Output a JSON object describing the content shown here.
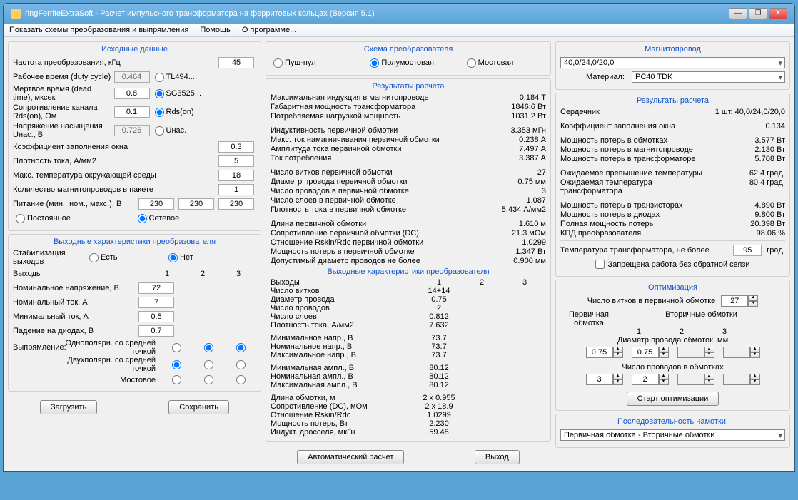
{
  "title": "ringFerriteExtraSoft - Расчет импульсного трансформатора на ферритовых кольцах (Версия 5.1)",
  "menu": {
    "schemes": "Показать схемы преобразования и выпрямления",
    "help": "Помощь",
    "about": "О программе..."
  },
  "sourceData": {
    "title": "Исходные данные",
    "freq_lbl": "Частота преобразования, кГц",
    "freq": "45",
    "duty_lbl": "Рабочее время (duty cycle)",
    "duty": "0.464",
    "duty_opt": "TL494...",
    "dead_lbl": "Мертвое время (dead time), мксек",
    "dead": "0.8",
    "dead_opt": "SG3525...",
    "rds_lbl": "Сопротивление канала Rds(on), Ом",
    "rds": "0.1",
    "rds_opt": "Rds(on)",
    "uhac_lbl": "Напряжение насыщения Uнас., В",
    "uhac": "0.726",
    "uhac_opt": "Uнас.",
    "kfill_lbl": "Коэффициент заполнения окна",
    "kfill": "0.3",
    "jdens_lbl": "Плотность тока, А/мм2",
    "jdens": "5",
    "tenv_lbl": "Макс. температура окружающей среды",
    "tenv": "18",
    "nmag_lbl": "Количество магнитопроводов  в пакете",
    "nmag": "1",
    "supply_lbl": "Питание (мин., ном., макс.), В",
    "smin": "230",
    "snom": "230",
    "smax": "230",
    "supply_dc": "Постоянное",
    "supply_ac": "Сетевое"
  },
  "outChar": {
    "title": "Выходные характеристики преобразователя",
    "stab_lbl": "Стабилизация выходов",
    "stab_yes": "Есть",
    "stab_no": "Нет",
    "outputs_lbl": "Выходы",
    "c1": "1",
    "c2": "2",
    "c3": "3",
    "vnom_lbl": "Номинальное напряжение, В",
    "vnom": "72",
    "inom_lbl": "Номинальный ток, А",
    "inom": "7",
    "imin_lbl": "Минимальный ток, А",
    "imin": "0.5",
    "vdiode_lbl": "Падение на диодах, В",
    "vdiode": "0.7",
    "rect_lbl": "Выпрямление:",
    "rect_uni": "Однополярн. со средней точкой",
    "rect_bi": "Двухполярн. со средней точкой",
    "rect_bridge": "Мостовое"
  },
  "buttons": {
    "load": "Загрузить",
    "save": "Сохранить",
    "auto": "Автоматический расчет",
    "exit": "Выход",
    "start_opt": "Старт оптимизации"
  },
  "scheme": {
    "title": "Схема преобразователя",
    "push": "Пуш-пул",
    "half": "Полумостовая",
    "bridge": "Мостовая"
  },
  "results": {
    "title": "Результаты расчета",
    "r": [
      [
        "Максимальная индукция в магнитопроводе",
        "0.184 Т"
      ],
      [
        "Габаритная мощность трансформатора",
        "1846.6 Вт"
      ],
      [
        "Потребляемая нагрузкой мощность",
        "1031.2 Вт"
      ],
      [
        "Индуктивность первичной обмотки",
        "3.353 мГн"
      ],
      [
        "Макс. ток намагничивания первичной обмотки",
        "0.238 А"
      ],
      [
        "Амплитуда тока первичной обмотки",
        "7.497 А"
      ],
      [
        "Ток потребления",
        "3.387 А"
      ],
      [
        "Число витков первичной обмотки",
        "27"
      ],
      [
        "Диаметр провода первичной обмотки",
        "0.75 мм"
      ],
      [
        "Число проводов в первичной обмотке",
        "3"
      ],
      [
        "Число слоев в первичной обмотке",
        "1.087"
      ],
      [
        "Плотность тока в первичной обмотке",
        "5.434 А/мм2"
      ],
      [
        "Длина  первичной обмотки",
        "1.610 м"
      ],
      [
        "Сопротивление первичной обмотки (DC)",
        "21.3 мОм"
      ],
      [
        "Отношение Rskin/Rdc первичной обмотки",
        "1.0299"
      ],
      [
        "Мощность потерь в первичной обмотке",
        "1.347 Вт"
      ],
      [
        "Допустимый диаметр проводов не более",
        "0.900 мм"
      ]
    ],
    "out_title": "Выходные характеристики преобразователя",
    "out_hdr": [
      "Выходы",
      "1",
      "2",
      "3"
    ],
    "out_rows": [
      [
        "Число витков",
        "14+14",
        "",
        ""
      ],
      [
        "Диаметр провода",
        "0.75",
        "",
        ""
      ],
      [
        "Число проводов",
        "2",
        "",
        ""
      ],
      [
        "Число слоев",
        "0.812",
        "",
        ""
      ],
      [
        "Плотность тока, А/мм2",
        "7.632",
        "",
        ""
      ],
      [
        "Минимальное напр., В",
        "73.7",
        "",
        ""
      ],
      [
        "Номинальное напр., В",
        "73.7",
        "",
        ""
      ],
      [
        "Максимальное напр., В",
        "73.7",
        "",
        ""
      ],
      [
        "Минимальная ампл., В",
        "80.12",
        "",
        ""
      ],
      [
        "Номинальная ампл., В",
        "80.12",
        "",
        ""
      ],
      [
        "Максимальная ампл., В",
        "80.12",
        "",
        ""
      ],
      [
        "Длина обмотки, м",
        "2 x 0.955",
        "",
        ""
      ],
      [
        "Сопротивление (DC), мОм",
        "2 x 18.9",
        "",
        ""
      ],
      [
        "Отношение Rskin/Rdc",
        "1.0299",
        "",
        ""
      ],
      [
        "Мощность потерь, Вт",
        "2.230",
        "",
        ""
      ],
      [
        "Индукт. дросселя, мкГн",
        "59.48",
        "",
        ""
      ]
    ]
  },
  "core": {
    "title": "Магнитопровод",
    "size": "40,0/24,0/20,0",
    "mat_lbl": "Материал:",
    "mat": "PC40 TDK"
  },
  "results2": {
    "title": "Результаты расчета",
    "r": [
      [
        "Сердечник",
        "1 шт. 40,0/24,0/20,0"
      ],
      [
        "Коэффициент заполнения окна",
        "0.134"
      ],
      [
        "Мощность потерь в обмотках",
        "3.577 Вт"
      ],
      [
        "Мощность потерь в магнитопроводе",
        "2.130 Вт"
      ],
      [
        "Мощность потерь в трансформаторе",
        "5.708 Вт"
      ],
      [
        "Ожидаемое превышение температуры",
        "62.4 град."
      ],
      [
        "Ожидаемая температура трансформатора",
        "80.4 град."
      ],
      [
        "Мощность потерь в транзисторах",
        "4.890 Вт"
      ],
      [
        "Мощность потерь в диодах",
        "9.800 Вт"
      ],
      [
        "Полная мощность потерь",
        "20.398 Вт"
      ],
      [
        "КПД преобразователя",
        "98.06 %"
      ]
    ],
    "tmax_lbl": "Температура трансформатора, не более",
    "tmax": "95",
    "tmax_unit": "град.",
    "chk": "Запрещена работа без обратной связи"
  },
  "opt": {
    "title": "Оптимизация",
    "turns_lbl": "Число витков в первичной обмотке",
    "turns": "27",
    "prim": "Первичная обмотка",
    "sec": "Вторичные обмотки",
    "c1": "1",
    "c2": "2",
    "c3": "3",
    "diam_lbl": "Диаметр провода обмоток, мм",
    "d0": "0.75",
    "d1": "0.75",
    "wires_lbl": "Число проводов в обмотках",
    "w0": "3",
    "w1": "2"
  },
  "seq": {
    "title": "Последовательность намотки:",
    "val": "Первичная обмотка - Вторичные обмотки"
  }
}
